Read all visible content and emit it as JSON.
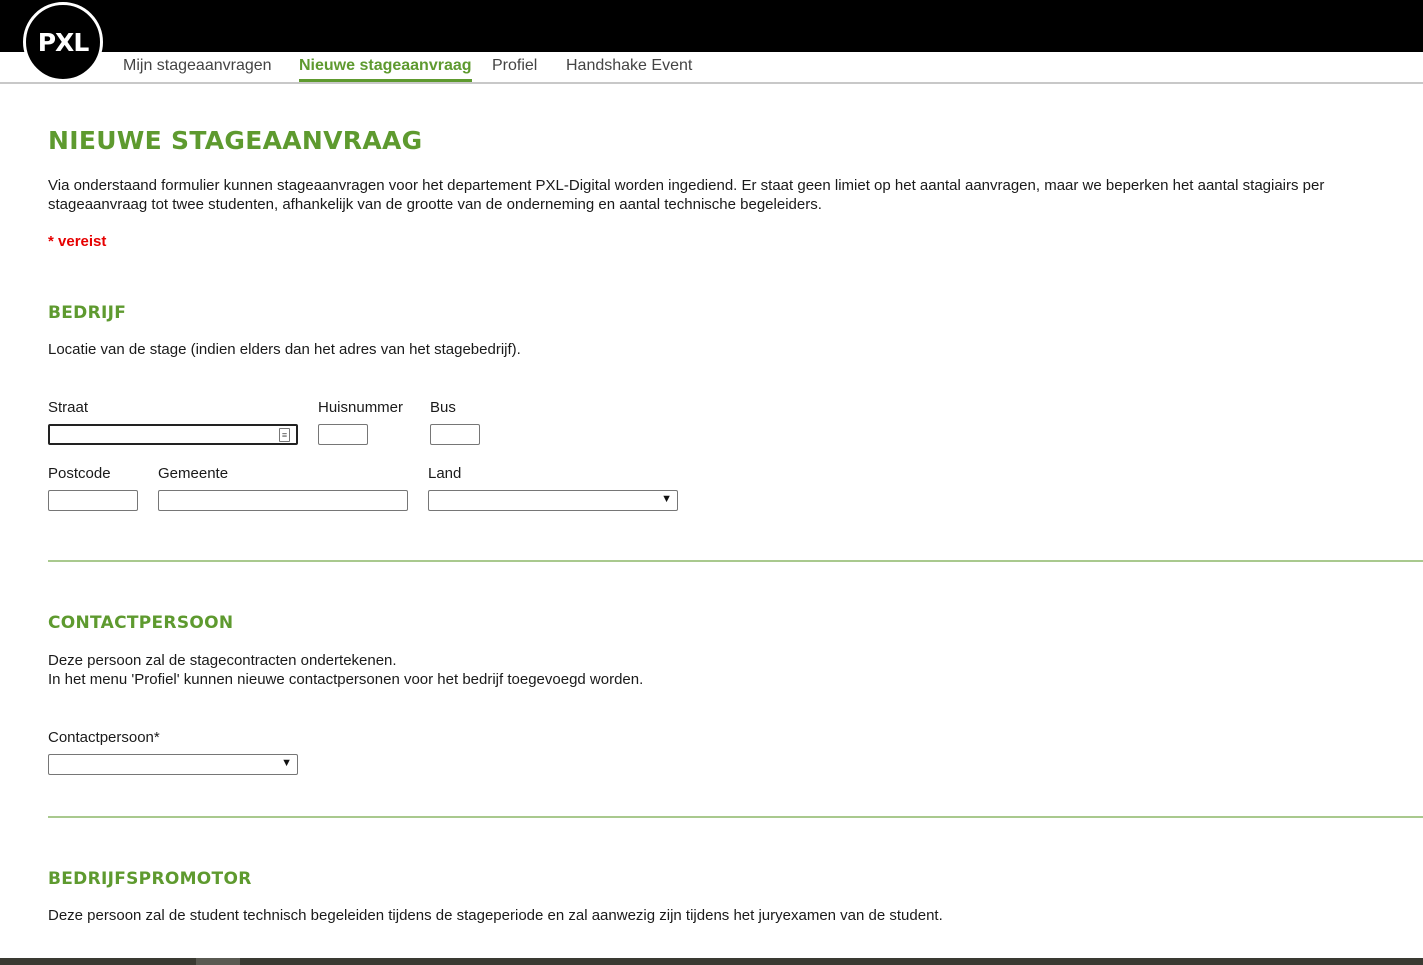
{
  "logo": {
    "text": "PXL"
  },
  "nav": {
    "items": [
      {
        "label": "Mijn stageaanvragen",
        "active": false
      },
      {
        "label": "Nieuwe stageaanvraag",
        "active": true
      },
      {
        "label": "Profiel",
        "active": false
      },
      {
        "label": "Handshake Event",
        "active": false
      }
    ]
  },
  "page": {
    "title": "NIEUWE STAGEAANVRAAG",
    "intro": "Via onderstaand formulier kunnen stageaanvragen voor het departement PXL-Digital worden ingediend. Er staat geen limiet op het aantal aanvragen, maar we beperken het aantal stagiairs per stageaanvraag tot twee studenten, afhankelijk van de grootte van de onderneming en aantal technische begeleiders.",
    "required_note": "* vereist"
  },
  "bedrijf": {
    "title": "BEDRIJF",
    "description": "Locatie van de stage (indien elders dan het adres van het stagebedrijf).",
    "straat_label": "Straat",
    "huisnummer_label": "Huisnummer",
    "bus_label": "Bus",
    "postcode_label": "Postcode",
    "gemeente_label": "Gemeente",
    "land_label": "Land",
    "straat_value": "",
    "huisnummer_value": "",
    "bus_value": "",
    "postcode_value": "",
    "gemeente_value": "",
    "land_value": ""
  },
  "contactpersoon": {
    "title": "CONTACTPERSOON",
    "description_line1": "Deze persoon zal de stagecontracten ondertekenen.",
    "description_line2": "In het menu 'Profiel' kunnen nieuwe contactpersonen voor het bedrijf toegevoegd worden.",
    "select_label": "Contactpersoon*",
    "select_value": ""
  },
  "bedrijfspromotor": {
    "title": "BEDRIJFSPROMOTOR",
    "description": "Deze persoon zal de student technisch begeleiden tijdens de stageperiode en zal aanwezig zijn tijdens het juryexamen van de student."
  },
  "colors": {
    "accent_green": "#5e9a2f",
    "divider_green": "#a9c98e",
    "required_red": "#e60000",
    "topbar": "#000000"
  }
}
